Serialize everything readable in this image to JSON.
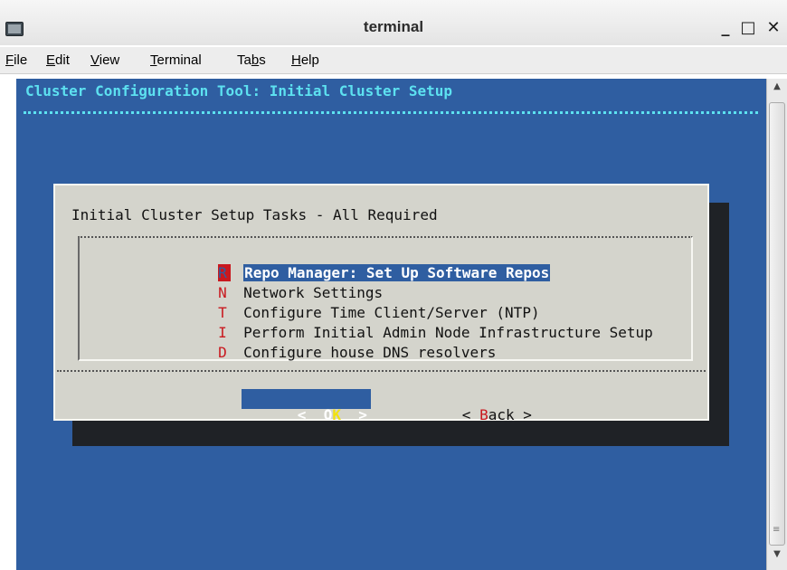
{
  "window": {
    "title": "terminal",
    "controls": {
      "minimize": "_",
      "maximize": "□",
      "close": "✕"
    }
  },
  "menubar": {
    "items": [
      {
        "pre": "",
        "ul": "F",
        "post": "ile"
      },
      {
        "pre": "",
        "ul": "E",
        "post": "dit"
      },
      {
        "pre": "",
        "ul": "V",
        "post": "iew"
      },
      {
        "pre": "",
        "ul": "T",
        "post": "erminal"
      },
      {
        "pre": "Ta",
        "ul": "b",
        "post": "s"
      },
      {
        "pre": "",
        "ul": "H",
        "post": "elp"
      }
    ]
  },
  "terminal": {
    "title": "Cluster Configuration Tool: Initial Cluster Setup",
    "dialog": {
      "heading": "Initial Cluster Setup Tasks - All Required",
      "items": [
        {
          "key": "R",
          "label": "Repo Manager: Set Up Software Repos",
          "selected": true
        },
        {
          "key": "N",
          "label": "Network Settings",
          "selected": false
        },
        {
          "key": "T",
          "label": "Configure Time Client/Server (NTP)",
          "selected": false
        },
        {
          "key": "I",
          "label": "Perform Initial Admin Node Infrastructure Setup",
          "selected": false
        },
        {
          "key": "D",
          "label": "Configure house DNS resolvers",
          "selected": false
        }
      ],
      "ok_button": {
        "pre": "<  ",
        "hotkey_pre": "O",
        "hotkey": "K",
        "post": "  >"
      },
      "back_button": {
        "pre": "< ",
        "hotkey": "B",
        "post": "ack >"
      }
    }
  },
  "scrollbar": {
    "up": "▲",
    "down": "▼",
    "grip": "≡"
  },
  "colors": {
    "terminal_bg": "#2f5ea1",
    "title_cyan": "#5de1f0",
    "dialog_bg": "#d4d4cc",
    "hotkey_red": "#c9181e",
    "hotkey_yellow": "#f2e20f"
  }
}
